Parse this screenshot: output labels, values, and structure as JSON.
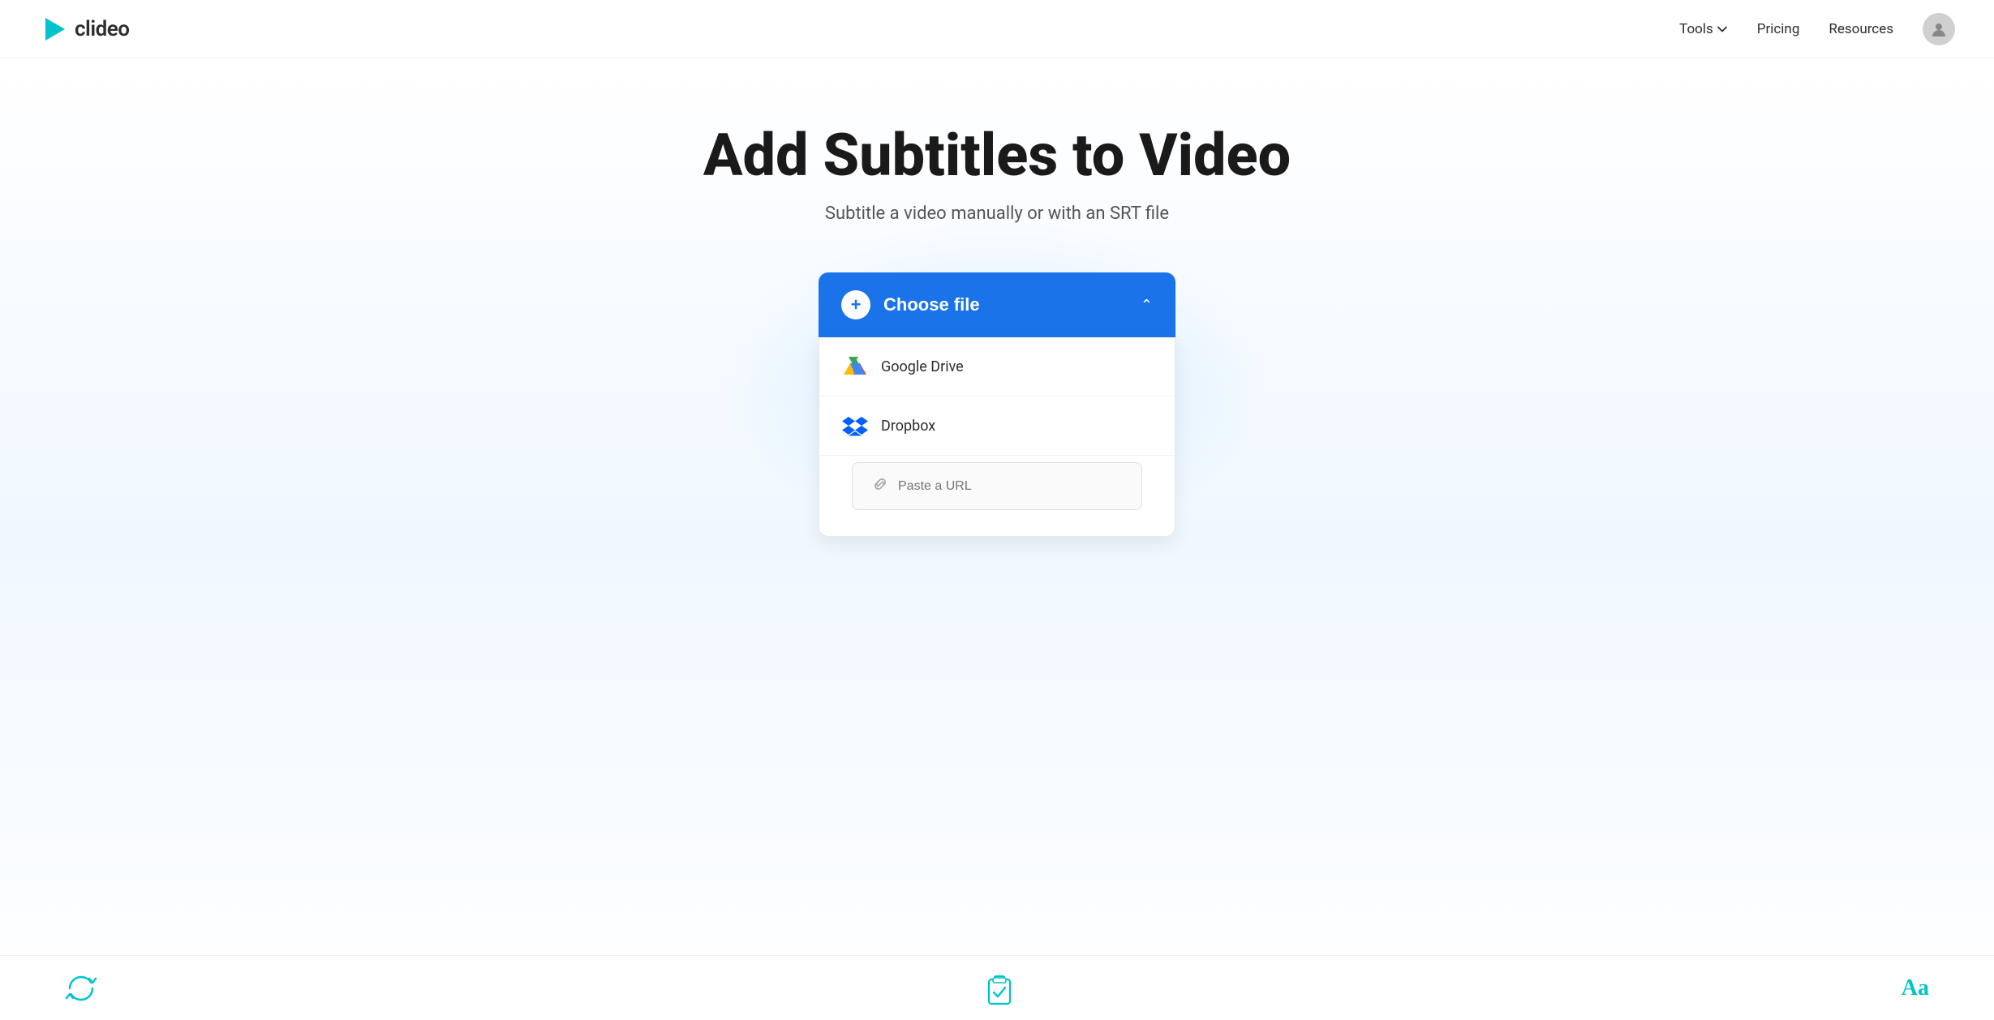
{
  "header": {
    "logo_text": "clideo",
    "nav": {
      "tools_label": "Tools",
      "pricing_label": "Pricing",
      "resources_label": "Resources"
    }
  },
  "main": {
    "title": "Add Subtitles to Video",
    "subtitle": "Subtitle a video manually or with an SRT file",
    "upload": {
      "choose_file_label": "Choose file",
      "google_drive_label": "Google Drive",
      "dropbox_label": "Dropbox",
      "url_placeholder": "Paste a URL"
    }
  },
  "bottom": {
    "refresh_icon_name": "refresh-icon",
    "clipboard_icon_name": "clipboard-check-icon",
    "text_icon_name": "text-size-icon",
    "text_icon_label": "Aa"
  },
  "colors": {
    "primary_blue": "#1a73e8",
    "teal": "#00c4cc",
    "dark_text": "#1a1a1a",
    "mid_text": "#555555"
  }
}
